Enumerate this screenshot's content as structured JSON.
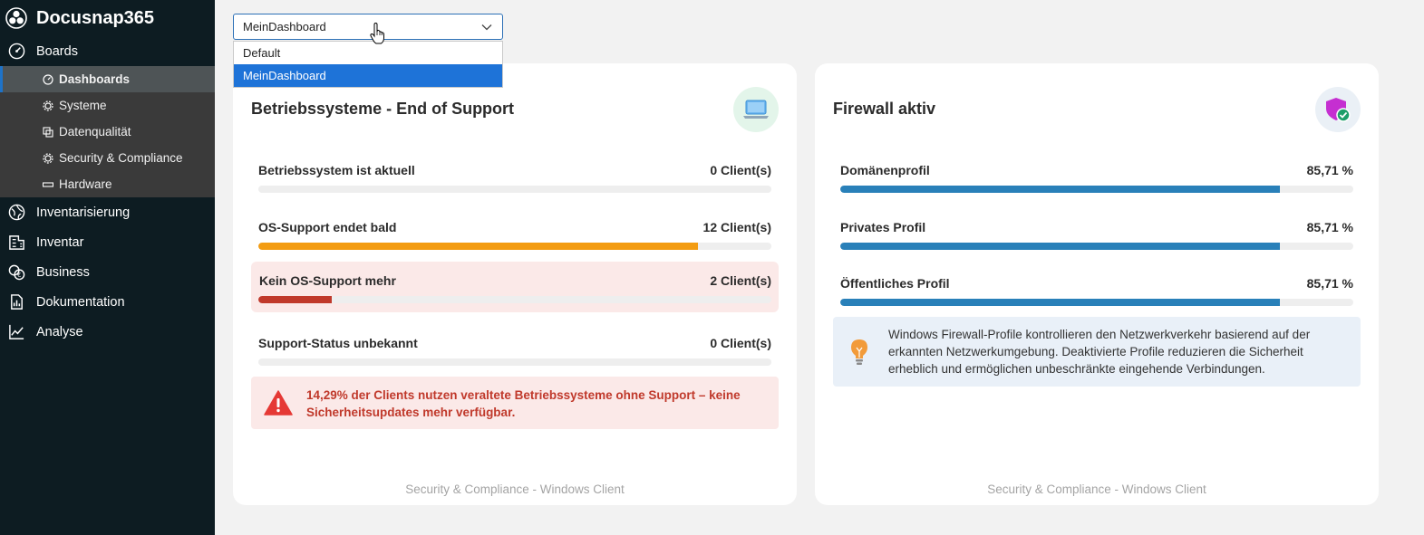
{
  "app": {
    "title": "Docusnap365"
  },
  "sidebar": {
    "sections": [
      {
        "label": "Boards",
        "icon": "gauge-icon"
      },
      {
        "label": "Inventarisierung",
        "icon": "globe-icon"
      },
      {
        "label": "Inventar",
        "icon": "building-icon"
      },
      {
        "label": "Business",
        "icon": "coins-icon"
      },
      {
        "label": "Dokumentation",
        "icon": "document-chart-icon"
      },
      {
        "label": "Analyse",
        "icon": "line-chart-icon"
      }
    ],
    "boards_sub": [
      {
        "label": "Dashboards",
        "icon": "gauge-icon",
        "active": true
      },
      {
        "label": "Systeme",
        "icon": "gear-icon"
      },
      {
        "label": "Datenqualität",
        "icon": "copy-icon"
      },
      {
        "label": "Security & Compliance",
        "icon": "gear-icon"
      },
      {
        "label": "Hardware",
        "icon": "rectangle-icon"
      }
    ]
  },
  "dashboard_select": {
    "value": "MeinDashboard",
    "options": [
      "Default",
      "MeinDashboard"
    ]
  },
  "card_os": {
    "title": "Betriebssysteme - End of Support",
    "rows": [
      {
        "label": "Betriebssystem ist aktuell",
        "value": "0 Client(s)",
        "fraction": 0,
        "color": "#f39c12"
      },
      {
        "label": "OS-Support endet bald",
        "value": "12 Client(s)",
        "fraction": 0.857,
        "color": "#f39c12"
      },
      {
        "label": "Kein OS-Support mehr",
        "value": "2 Client(s)",
        "fraction": 0.143,
        "color": "#c0392b"
      },
      {
        "label": "Support-Status unbekannt",
        "value": "0 Client(s)",
        "fraction": 0,
        "color": "#f39c12"
      }
    ],
    "alert": "14,29% der Clients nutzen veraltete Betriebssysteme ohne Support – keine Sicherheitsupdates mehr verfügbar.",
    "footer": "Security & Compliance - Windows Client"
  },
  "card_fw": {
    "title": "Firewall aktiv",
    "rows": [
      {
        "label": "Domänenprofil",
        "value": "85,71 %",
        "fraction": 0.8571,
        "color": "#2980b9"
      },
      {
        "label": "Privates Profil",
        "value": "85,71 %",
        "fraction": 0.8571,
        "color": "#2980b9"
      },
      {
        "label": "Öffentliches Profil",
        "value": "85,71 %",
        "fraction": 0.8571,
        "color": "#2980b9"
      }
    ],
    "info": "Windows Firewall-Profile kontrollieren den Netzwerkverkehr basierend auf der erkannten Netzwerkumgebung. Deaktivierte Profile reduzieren die Sicherheit erheblich und ermöglichen unbeschränkte eingehende Verbindungen.",
    "footer": "Security & Compliance - Windows Client"
  }
}
